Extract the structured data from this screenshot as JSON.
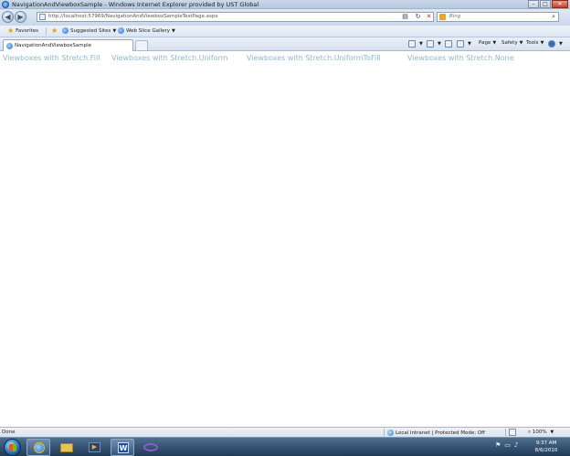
{
  "window": {
    "title": "NavigationAndViewboxSample - Windows Internet Explorer provided by UST Global",
    "minimize": "–",
    "maximize": "□",
    "close": "✕"
  },
  "address": {
    "url": "http://localhost:57969/NavigationAndViewboxSampleTestPage.aspx",
    "search_placeholder": "Bing"
  },
  "favorites": {
    "favorites_label": "Favorites",
    "items": [
      {
        "label": "Suggested Sites"
      },
      {
        "label": "Web Slice Gallery"
      }
    ]
  },
  "tabs": {
    "active_tab": "NavigationAndViewboxSample"
  },
  "commandbar": {
    "page": "Page",
    "safety": "Safety",
    "tools": "Tools"
  },
  "content": {
    "labels": [
      "Viewboxes with Stretch.Fill",
      "Viewboxes with Stretch.Uniform",
      "Viewboxes with Stretch.UniformToFill",
      "Viewboxes with Stretch.None"
    ]
  },
  "status": {
    "done": "Done",
    "zone": "Local intranet | Protected Mode: Off",
    "zoom": "100%"
  },
  "taskbar": {
    "time": "9:37 AM",
    "date": "8/6/2010"
  }
}
